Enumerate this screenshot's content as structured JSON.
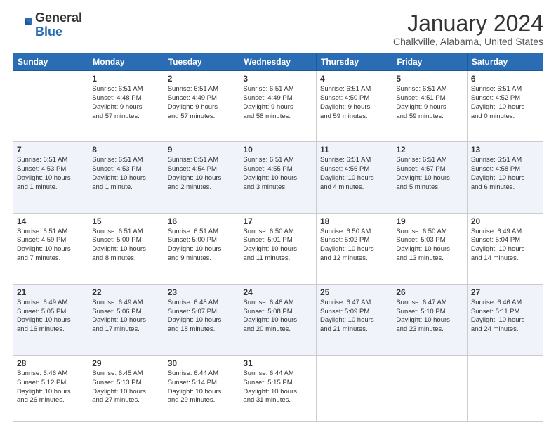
{
  "logo": {
    "general": "General",
    "blue": "Blue"
  },
  "header": {
    "month": "January 2024",
    "location": "Chalkville, Alabama, United States"
  },
  "days_of_week": [
    "Sunday",
    "Monday",
    "Tuesday",
    "Wednesday",
    "Thursday",
    "Friday",
    "Saturday"
  ],
  "weeks": [
    [
      {
        "day": "",
        "info": ""
      },
      {
        "day": "1",
        "info": "Sunrise: 6:51 AM\nSunset: 4:48 PM\nDaylight: 9 hours\nand 57 minutes."
      },
      {
        "day": "2",
        "info": "Sunrise: 6:51 AM\nSunset: 4:49 PM\nDaylight: 9 hours\nand 57 minutes."
      },
      {
        "day": "3",
        "info": "Sunrise: 6:51 AM\nSunset: 4:49 PM\nDaylight: 9 hours\nand 58 minutes."
      },
      {
        "day": "4",
        "info": "Sunrise: 6:51 AM\nSunset: 4:50 PM\nDaylight: 9 hours\nand 59 minutes."
      },
      {
        "day": "5",
        "info": "Sunrise: 6:51 AM\nSunset: 4:51 PM\nDaylight: 9 hours\nand 59 minutes."
      },
      {
        "day": "6",
        "info": "Sunrise: 6:51 AM\nSunset: 4:52 PM\nDaylight: 10 hours\nand 0 minutes."
      }
    ],
    [
      {
        "day": "7",
        "info": "Sunrise: 6:51 AM\nSunset: 4:53 PM\nDaylight: 10 hours\nand 1 minute."
      },
      {
        "day": "8",
        "info": "Sunrise: 6:51 AM\nSunset: 4:53 PM\nDaylight: 10 hours\nand 1 minute."
      },
      {
        "day": "9",
        "info": "Sunrise: 6:51 AM\nSunset: 4:54 PM\nDaylight: 10 hours\nand 2 minutes."
      },
      {
        "day": "10",
        "info": "Sunrise: 6:51 AM\nSunset: 4:55 PM\nDaylight: 10 hours\nand 3 minutes."
      },
      {
        "day": "11",
        "info": "Sunrise: 6:51 AM\nSunset: 4:56 PM\nDaylight: 10 hours\nand 4 minutes."
      },
      {
        "day": "12",
        "info": "Sunrise: 6:51 AM\nSunset: 4:57 PM\nDaylight: 10 hours\nand 5 minutes."
      },
      {
        "day": "13",
        "info": "Sunrise: 6:51 AM\nSunset: 4:58 PM\nDaylight: 10 hours\nand 6 minutes."
      }
    ],
    [
      {
        "day": "14",
        "info": "Sunrise: 6:51 AM\nSunset: 4:59 PM\nDaylight: 10 hours\nand 7 minutes."
      },
      {
        "day": "15",
        "info": "Sunrise: 6:51 AM\nSunset: 5:00 PM\nDaylight: 10 hours\nand 8 minutes."
      },
      {
        "day": "16",
        "info": "Sunrise: 6:51 AM\nSunset: 5:00 PM\nDaylight: 10 hours\nand 9 minutes."
      },
      {
        "day": "17",
        "info": "Sunrise: 6:50 AM\nSunset: 5:01 PM\nDaylight: 10 hours\nand 11 minutes."
      },
      {
        "day": "18",
        "info": "Sunrise: 6:50 AM\nSunset: 5:02 PM\nDaylight: 10 hours\nand 12 minutes."
      },
      {
        "day": "19",
        "info": "Sunrise: 6:50 AM\nSunset: 5:03 PM\nDaylight: 10 hours\nand 13 minutes."
      },
      {
        "day": "20",
        "info": "Sunrise: 6:49 AM\nSunset: 5:04 PM\nDaylight: 10 hours\nand 14 minutes."
      }
    ],
    [
      {
        "day": "21",
        "info": "Sunrise: 6:49 AM\nSunset: 5:05 PM\nDaylight: 10 hours\nand 16 minutes."
      },
      {
        "day": "22",
        "info": "Sunrise: 6:49 AM\nSunset: 5:06 PM\nDaylight: 10 hours\nand 17 minutes."
      },
      {
        "day": "23",
        "info": "Sunrise: 6:48 AM\nSunset: 5:07 PM\nDaylight: 10 hours\nand 18 minutes."
      },
      {
        "day": "24",
        "info": "Sunrise: 6:48 AM\nSunset: 5:08 PM\nDaylight: 10 hours\nand 20 minutes."
      },
      {
        "day": "25",
        "info": "Sunrise: 6:47 AM\nSunset: 5:09 PM\nDaylight: 10 hours\nand 21 minutes."
      },
      {
        "day": "26",
        "info": "Sunrise: 6:47 AM\nSunset: 5:10 PM\nDaylight: 10 hours\nand 23 minutes."
      },
      {
        "day": "27",
        "info": "Sunrise: 6:46 AM\nSunset: 5:11 PM\nDaylight: 10 hours\nand 24 minutes."
      }
    ],
    [
      {
        "day": "28",
        "info": "Sunrise: 6:46 AM\nSunset: 5:12 PM\nDaylight: 10 hours\nand 26 minutes."
      },
      {
        "day": "29",
        "info": "Sunrise: 6:45 AM\nSunset: 5:13 PM\nDaylight: 10 hours\nand 27 minutes."
      },
      {
        "day": "30",
        "info": "Sunrise: 6:44 AM\nSunset: 5:14 PM\nDaylight: 10 hours\nand 29 minutes."
      },
      {
        "day": "31",
        "info": "Sunrise: 6:44 AM\nSunset: 5:15 PM\nDaylight: 10 hours\nand 31 minutes."
      },
      {
        "day": "",
        "info": ""
      },
      {
        "day": "",
        "info": ""
      },
      {
        "day": "",
        "info": ""
      }
    ]
  ]
}
